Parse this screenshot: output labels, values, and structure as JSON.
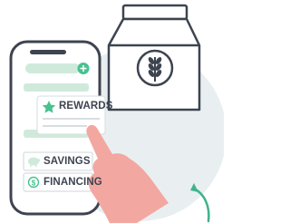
{
  "menu": {
    "rewards_label": "REWARDS",
    "savings_label": "SAVINGS",
    "financing_label": "FINANCING"
  },
  "icons": {
    "bag": "flour-bag-icon",
    "wheat": "wheat-icon",
    "star": "star-icon",
    "piggy": "piggy-bank-icon",
    "dollar": "dollar-coin-icon",
    "plus": "plus-icon",
    "refresh": "refresh-arrow-icon"
  },
  "colors": {
    "accent_green": "#48c28f",
    "pale_green": "#cfeadb",
    "background_blob": "#e9eff1",
    "outline": "#3d4450",
    "hand_pink": "#f2a7a0",
    "refresh_teal": "#3fb38c"
  }
}
